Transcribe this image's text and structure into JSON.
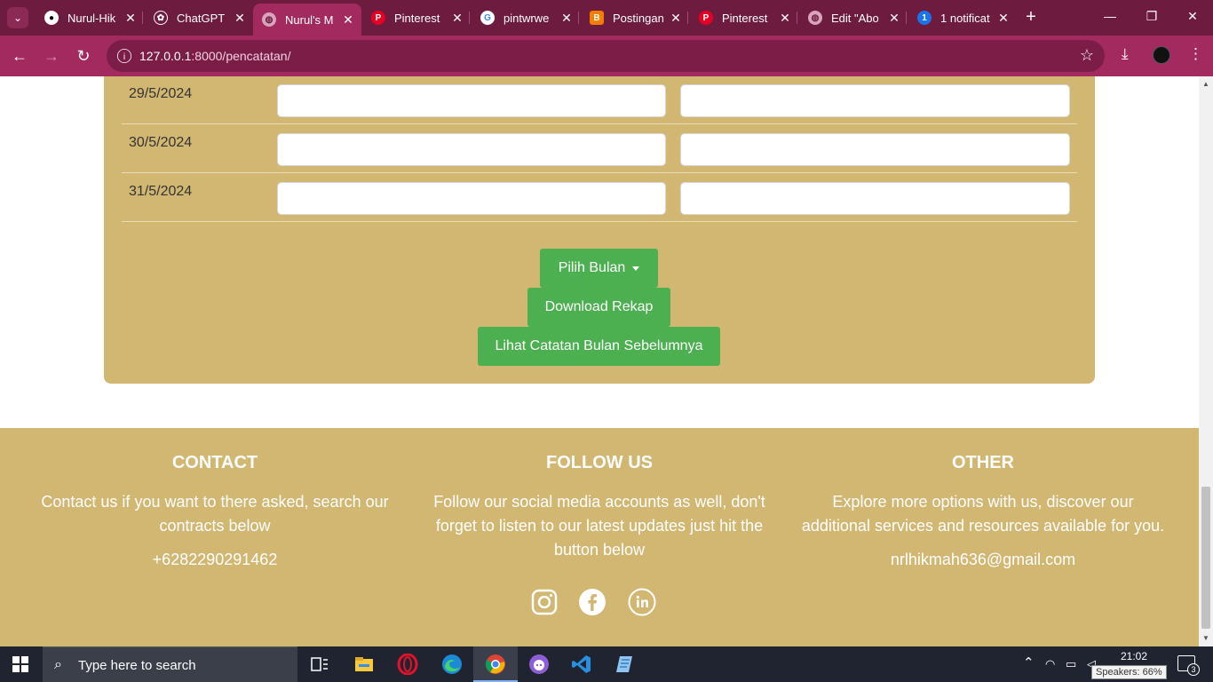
{
  "browser": {
    "tabs": [
      {
        "label": "Nurul-Hik",
        "icon": "github-icon"
      },
      {
        "label": "ChatGPT",
        "icon": "chatgpt-icon"
      },
      {
        "label": "Nurul's M",
        "icon": "globe-icon",
        "active": true
      },
      {
        "label": "Pinterest",
        "icon": "pinterest-icon"
      },
      {
        "label": "pintwrwe",
        "icon": "google-icon"
      },
      {
        "label": "Postingan",
        "icon": "blogger-icon"
      },
      {
        "label": "Pinterest",
        "icon": "pinterest-icon"
      },
      {
        "label": "Edit \"Abo",
        "icon": "globe-icon"
      },
      {
        "label": "1 notificat",
        "icon": "notification-icon",
        "badge": "1"
      }
    ],
    "url_host": "127.0.0.1",
    "url_path": ":8000/pencatatan/"
  },
  "page": {
    "rows": [
      {
        "date": "29/5/2024"
      },
      {
        "date": "30/5/2024"
      },
      {
        "date": "31/5/2024"
      }
    ],
    "buttons": {
      "choose_month": "Pilih Bulan",
      "download": "Download Rekap",
      "previous": "Lihat Catatan Bulan Sebelumnya"
    }
  },
  "footer": {
    "contact": {
      "title": "CONTACT",
      "desc_line1": "Contact us if you want to there asked, search our",
      "desc_line2": "contracts below",
      "phone": "+6282290291462"
    },
    "follow": {
      "title": "FOLLOW US",
      "desc_line1": "Follow our social media accounts as well, don't",
      "desc_line2": "forget to listen to our latest updates just hit the",
      "desc_line3": "button below"
    },
    "other": {
      "title": "OTHER",
      "desc_line1": "Explore more options with us, discover our",
      "desc_line2": "additional services and resources available for you.",
      "email": "nrlhikmah636@gmail.com"
    }
  },
  "taskbar": {
    "search_placeholder": "Type here to search",
    "time": "21:02",
    "speakers": "Speakers: 66%",
    "notification_count": "3"
  },
  "colors": {
    "tabbar": "#6e1b40",
    "toolbar": "#a22a5e",
    "card": "#d2b772",
    "button": "#4caf50"
  }
}
